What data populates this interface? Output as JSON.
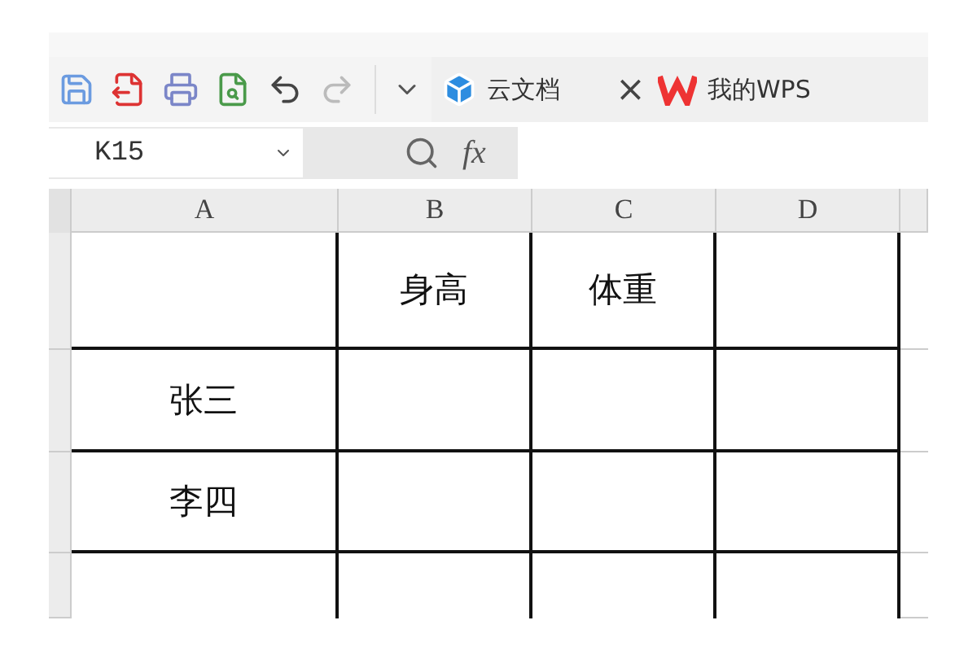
{
  "toolbar": {
    "buttons": [
      {
        "kind": "save",
        "disabled": false
      },
      {
        "kind": "export-pdf",
        "disabled": false
      },
      {
        "kind": "print",
        "disabled": false
      },
      {
        "kind": "preview",
        "disabled": false
      },
      {
        "kind": "undo",
        "disabled": false
      },
      {
        "kind": "redo",
        "disabled": true
      }
    ]
  },
  "tabs": [
    {
      "kind": "cloud",
      "label": "云文档",
      "close": "×"
    },
    {
      "kind": "wps",
      "label": "我的WPS"
    }
  ],
  "name_box": {
    "value": "K15"
  },
  "formula_bar": {
    "fx": "fx"
  },
  "columns": [
    "A",
    "B",
    "C",
    "D"
  ],
  "rows": [
    {
      "cells": [
        "",
        "身高",
        "体重",
        ""
      ]
    },
    {
      "cells": [
        "张三",
        "",
        "",
        ""
      ]
    },
    {
      "cells": [
        "李四",
        "",
        "",
        ""
      ]
    },
    {
      "cells": [
        "",
        "",
        "",
        ""
      ]
    }
  ]
}
